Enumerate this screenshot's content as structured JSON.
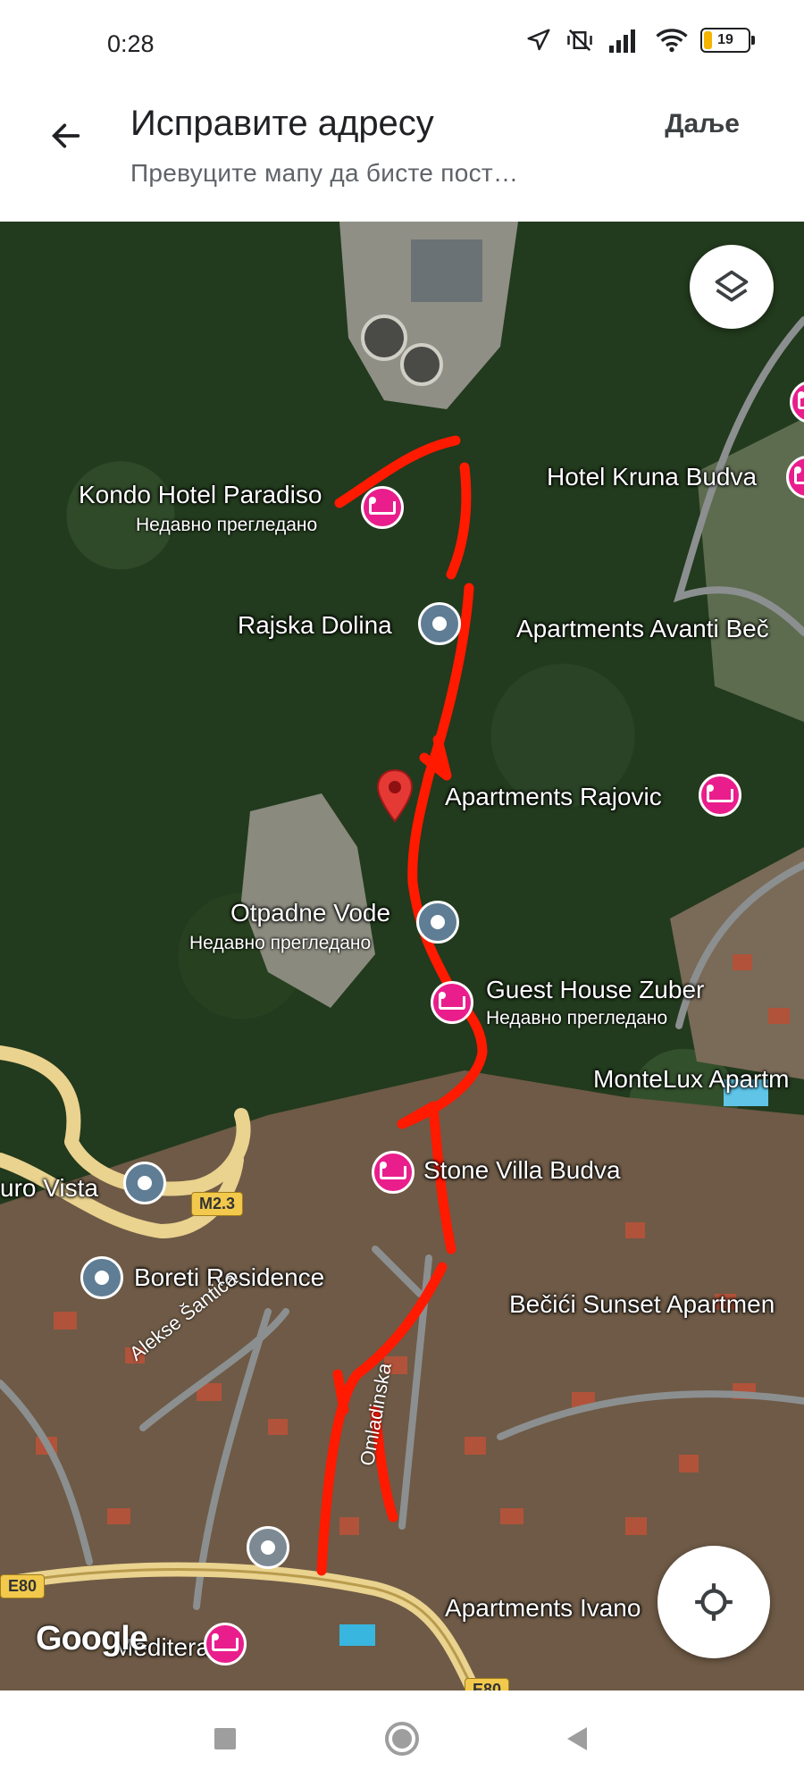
{
  "status_bar": {
    "time": "0:28",
    "battery_level": "19",
    "battery_fraction": 0.19
  },
  "app_bar": {
    "title": "Исправите адресу",
    "subtitle": "Превуците мапу да бисте пост…",
    "next_label": "Даље",
    "back_icon": "arrow-back-icon"
  },
  "map": {
    "places": [
      {
        "name": "Kondo Hotel Paradiso",
        "sub": "Недавно прегледано",
        "kind": "hotel"
      },
      {
        "name": "Hotel Kruna Budva",
        "sub": "",
        "kind": "hotel"
      },
      {
        "name": "Rajska Dolina",
        "sub": "",
        "kind": "poi"
      },
      {
        "name": "Apartments Avanti Beč",
        "sub": "",
        "kind": "text"
      },
      {
        "name": "Apartments Rajovic",
        "sub": "",
        "kind": "hotel"
      },
      {
        "name": "Otpadne Vode",
        "sub": "Недавно прегледано",
        "kind": "poi"
      },
      {
        "name": "Guest House Zuber",
        "sub": "Недавно прегледано",
        "kind": "hotel"
      },
      {
        "name": "MonteLux Apartm",
        "sub": "",
        "kind": "text"
      },
      {
        "name": "Stone Villa Budva",
        "sub": "",
        "kind": "hotel"
      },
      {
        "name": "uro Vista",
        "sub": "",
        "kind": "poi"
      },
      {
        "name": "Boreti Residence",
        "sub": "",
        "kind": "poi"
      },
      {
        "name": "Bečići Sunset Apartmen",
        "sub": "",
        "kind": "text"
      },
      {
        "name": "Apartments Ivano",
        "sub": "",
        "kind": "text"
      },
      {
        "name": "Mediteran",
        "sub": "",
        "kind": "hotel"
      }
    ],
    "roads": {
      "m23": "M2.3",
      "e80_left": "E80",
      "e80_bottom": "E80",
      "aleksa": "Alekse Šantića",
      "omladinska": "Omladinska"
    },
    "attribution": "Google",
    "layers_icon": "layers-icon",
    "locate_icon": "my-location-icon",
    "pin_icon": "location-pin-icon"
  },
  "nav_bar": {
    "recents_icon": "square-icon",
    "home_icon": "circle-icon",
    "back_icon": "triangle-back-icon"
  },
  "colors": {
    "hotel_pin": "#e91e8c",
    "poi_pin": "#5f7d95",
    "route": "#ff1a00",
    "road": "#f2d489"
  }
}
